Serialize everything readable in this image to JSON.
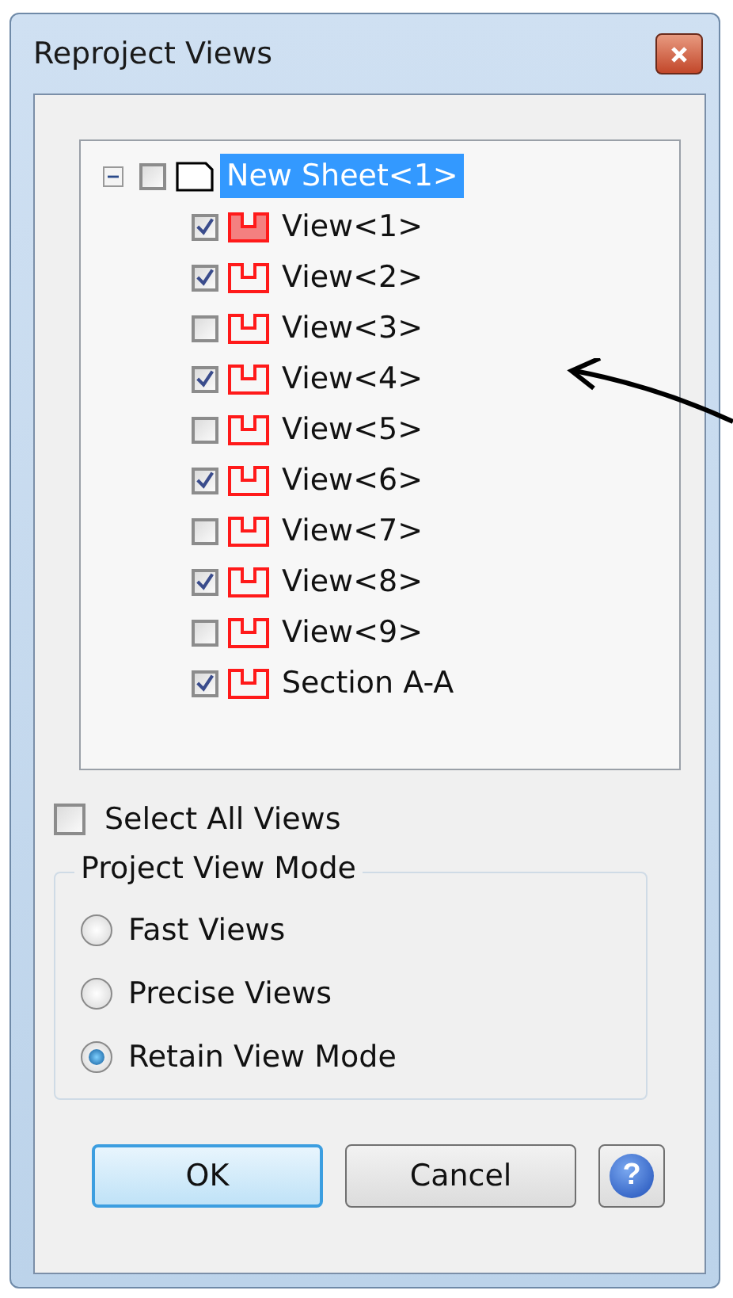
{
  "window": {
    "title": "Reproject Views"
  },
  "tree": [
    {
      "label": "New Sheet<1>",
      "kind": "sheet",
      "expanded": true,
      "checked": false,
      "selected": true,
      "children": [
        {
          "label": "View<1>",
          "kind": "view",
          "checked": true,
          "selected": false,
          "highlighted": true
        },
        {
          "label": "View<2>",
          "kind": "view",
          "checked": true,
          "selected": false,
          "highlighted": false
        },
        {
          "label": "View<3>",
          "kind": "view",
          "checked": false,
          "selected": false,
          "highlighted": false
        },
        {
          "label": "View<4>",
          "kind": "view",
          "checked": true,
          "selected": false,
          "highlighted": false
        },
        {
          "label": "View<5>",
          "kind": "view",
          "checked": false,
          "selected": false,
          "highlighted": false
        },
        {
          "label": "View<6>",
          "kind": "view",
          "checked": true,
          "selected": false,
          "highlighted": false
        },
        {
          "label": "View<7>",
          "kind": "view",
          "checked": false,
          "selected": false,
          "highlighted": false
        },
        {
          "label": "View<8>",
          "kind": "view",
          "checked": true,
          "selected": false,
          "highlighted": false
        },
        {
          "label": "View<9>",
          "kind": "view",
          "checked": false,
          "selected": false,
          "highlighted": false
        },
        {
          "label": "Section A-A",
          "kind": "view",
          "checked": true,
          "selected": false,
          "highlighted": false
        }
      ]
    }
  ],
  "select_all": {
    "label": "Select All Views",
    "checked": false
  },
  "mode_group": {
    "title": "Project View Mode",
    "options": [
      {
        "label": "Fast Views",
        "selected": false
      },
      {
        "label": "Precise Views",
        "selected": false
      },
      {
        "label": "Retain View Mode",
        "selected": true
      }
    ]
  },
  "buttons": [
    {
      "label": "OK",
      "kind": "default"
    },
    {
      "label": "Cancel",
      "kind": "normal"
    }
  ],
  "help": {
    "symbol": "?"
  }
}
